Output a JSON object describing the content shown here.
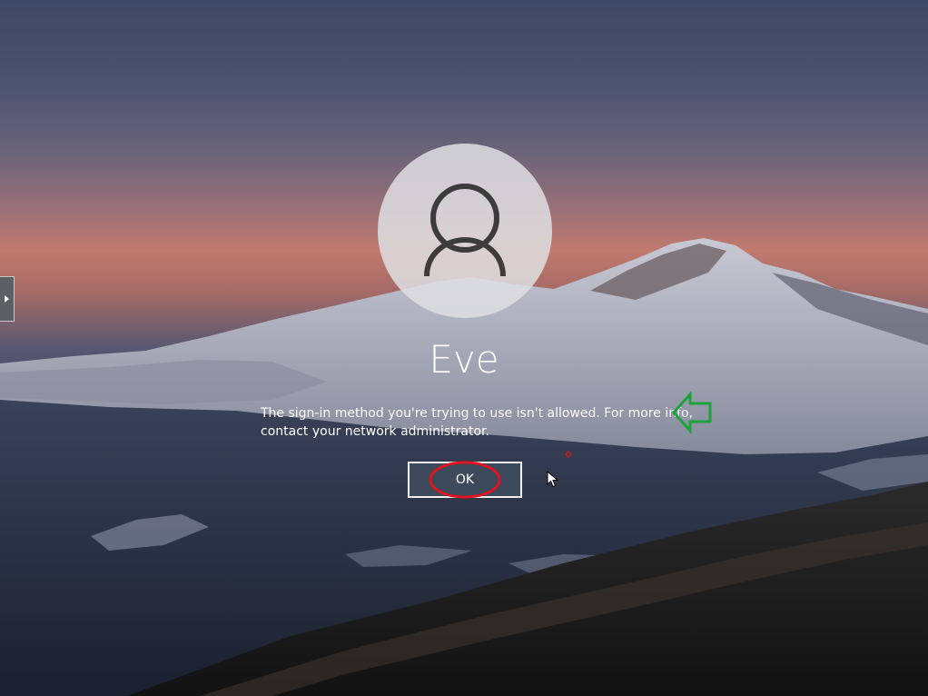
{
  "lock_screen": {
    "user": {
      "name": "Eve",
      "avatar_icon": "user-silhouette-icon"
    },
    "message": {
      "line1": "The sign-in method you're trying to use isn't allowed. For more info,",
      "line2": "contact your network administrator."
    },
    "ok_button": {
      "label": "OK"
    },
    "side_handle": {
      "icon": "expand-arrow-icon"
    }
  },
  "annotations": {
    "green_arrow_color": "#1aa33a",
    "red_circle_color": "#e0141e"
  }
}
